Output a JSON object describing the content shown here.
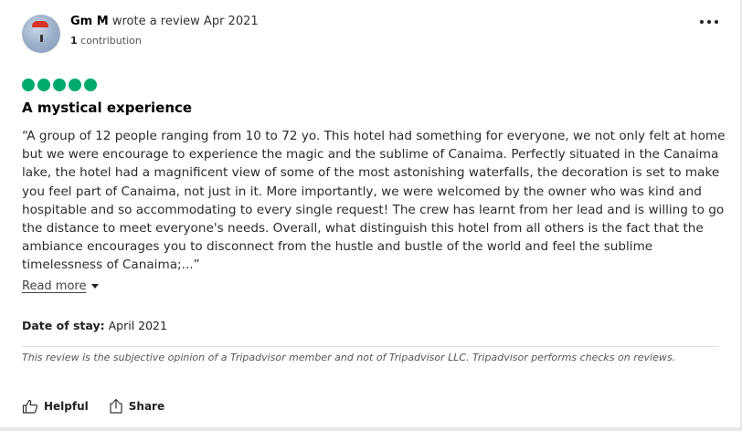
{
  "review": {
    "author": "Gm M",
    "wrote_text": "wrote a review Apr 2021",
    "contribution_count": "1",
    "contribution_label": "contribution",
    "rating_value": 5,
    "rating_max": 5,
    "title": "A mystical experience",
    "body": "“A group of 12 people ranging from 10 to 72 yo. This hotel had something for everyone, we not only felt at home but we were encourage to experience the magic and the sublime of Canaima. Perfectly situated in the Canaima lake, the hotel had a magnificent view of some of the most astonishing waterfalls, the decoration is set to make you feel part of Canaima, not just in it. More importantly, we were welcomed by the owner who was kind and hospitable and so accommodating to every single request! The crew has learnt from her lead and is willing to go the distance to meet everyone's needs. Overall, what distinguish this hotel from all others is the fact that the ambiance encourages you to disconnect from the hustle and bustle of the world and feel the sublime timelessness of Canaima;...”",
    "read_more_label": "Read more",
    "date_of_stay_label": "Date of stay:",
    "date_of_stay_value": "April 2021",
    "disclaimer": "This review is the subjective opinion of a Tripadvisor member and not of Tripadvisor LLC. Tripadvisor performs checks on reviews."
  },
  "actions": {
    "helpful_label": "Helpful",
    "share_label": "Share"
  },
  "icons": {
    "more": "more-horizontal-icon",
    "helpful": "thumbs-up-icon",
    "share": "share-icon",
    "read_more": "caret-down-icon"
  },
  "colors": {
    "rating_bubble": "#00aa6c",
    "text": "#2b2b2b"
  }
}
